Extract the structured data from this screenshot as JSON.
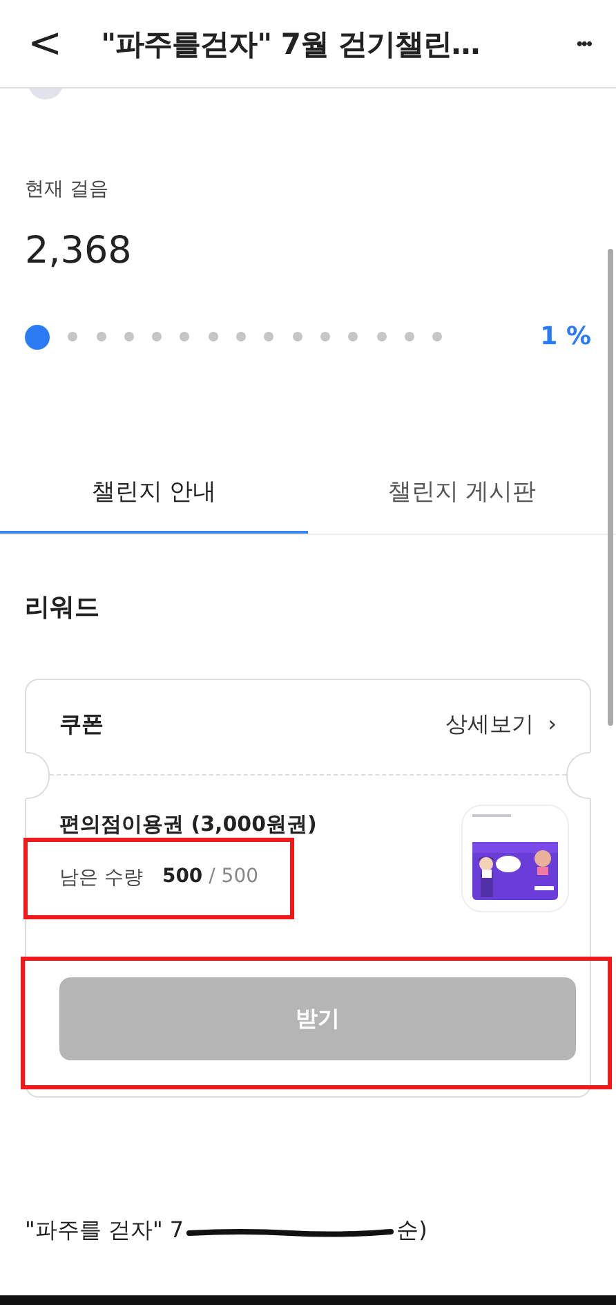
{
  "header": {
    "title": "\"파주를걷자\" 7월 걷기챌린…",
    "back": "<",
    "more": "•••"
  },
  "steps": {
    "label": "현재 걸음",
    "value": "2,368",
    "dots": [
      {
        "reached": true
      },
      {
        "reached": false
      },
      {
        "reached": false
      },
      {
        "reached": false
      },
      {
        "reached": false
      },
      {
        "reached": false
      },
      {
        "reached": false
      },
      {
        "reached": false
      },
      {
        "reached": false
      },
      {
        "reached": false
      },
      {
        "reached": false
      },
      {
        "reached": false
      },
      {
        "reached": false
      },
      {
        "reached": false
      },
      {
        "reached": false
      }
    ],
    "percent": "1 %"
  },
  "tabs": [
    {
      "label": "챌린지 안내",
      "selected": true
    },
    {
      "label": "챌린지 게시판",
      "selected": false
    }
  ],
  "reward": {
    "heading": "리워드",
    "coupon_label": "쿠폰",
    "details_link": "상세보기",
    "details_chevron": "›",
    "item_name": "편의점이용권 (3,000원권)",
    "remaining_label": "남은 수량",
    "remaining_value": "500",
    "remaining_separator": "/",
    "remaining_total": "500",
    "receive_button": {
      "label": "받기",
      "disabled": true
    }
  },
  "footer_title": "\"파주를 걷자\" 7",
  "footer_tail": "순)"
}
